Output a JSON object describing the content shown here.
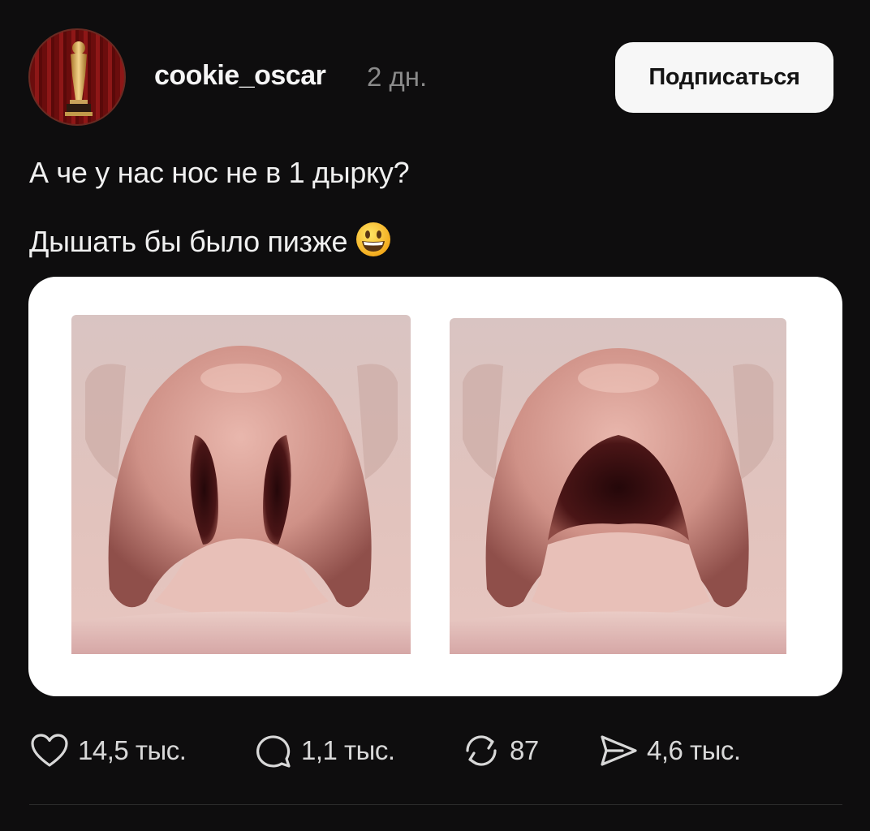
{
  "post": {
    "author": {
      "username": "cookie_oscar",
      "time_ago": "2 дн.",
      "avatar_icon": "oscar-statuette-icon"
    },
    "subscribe_label": "Подписаться",
    "text_lines": [
      "А че у нас нос не в 1 дырку?",
      "Дышать бы было пизже"
    ],
    "emoji": "grinning-face-icon"
  },
  "actions": {
    "like": {
      "icon": "heart-icon",
      "count": "14,5 тыс."
    },
    "comment": {
      "icon": "comment-bubble-icon",
      "count": "1,1 тыс."
    },
    "repost": {
      "icon": "repost-arrows-icon",
      "count": "87"
    },
    "share": {
      "icon": "send-icon",
      "count": "4,6 тыс."
    }
  },
  "colors": {
    "background": "#0e0d0e",
    "button_bg": "#f7f7f7",
    "muted_text": "#8a8a8a",
    "skin": "#d9a39b",
    "nostril": "#3a0f12"
  }
}
